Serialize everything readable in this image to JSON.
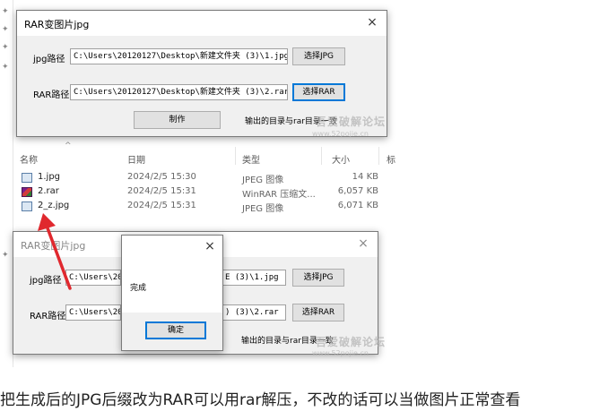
{
  "top_dialog": {
    "title": "RAR变图片jpg",
    "close": "×",
    "jpg_label": "jpg路径",
    "jpg_path": "C:\\Users\\20120127\\Desktop\\新建文件夹 (3)\\1.jpg",
    "jpg_button": "选择JPG",
    "rar_label": "RAR路径",
    "rar_path": "C:\\Users\\20120127\\Desktop\\新建文件夹 (3)\\2.rar",
    "rar_button": "选择RAR",
    "make_button": "制作",
    "output_note": "输出的目录与rar目录一致"
  },
  "explorer": {
    "columns": [
      "名称",
      "日期",
      "类型",
      "大小",
      "标"
    ],
    "files": [
      {
        "name": "1.jpg",
        "date": "2024/2/5 15:30",
        "type": "JPEG 图像",
        "size": "14 KB",
        "icon": "jpeg-file-icon"
      },
      {
        "name": "2.rar",
        "date": "2024/2/5 15:31",
        "type": "WinRAR 压缩文...",
        "size": "6,057 KB",
        "icon": "winrar-file-icon"
      },
      {
        "name": "2_z.jpg",
        "date": "2024/2/5 15:31",
        "type": "JPEG 图像",
        "size": "6,071 KB",
        "icon": "jpeg-file-icon"
      }
    ]
  },
  "bottom_dialog": {
    "title": "RAR变图片jpg",
    "close": "×",
    "jpg_label": "jpg路径",
    "jpg_path_left": "C:\\Users\\2012",
    "jpg_path_right": "E (3)\\1.jpg",
    "jpg_button": "选择JPG",
    "rar_label": "RAR路径",
    "rar_path_left": "C:\\Users\\2012",
    "rar_path_right": ") (3)\\2.rar",
    "rar_button": "选择RAR",
    "output_note": "输出的目录与rar目录一致"
  },
  "message_box": {
    "close": "×",
    "message": "完成",
    "ok_button": "确定"
  },
  "watermark": {
    "text": "吾爱破解论坛",
    "url": "www.52pojie.cn"
  },
  "caption": "把生成后的JPG后缀改为RAR可以用rar解压，不改的话可以当做图片正常查看",
  "colors": {
    "arrow": "#e0282e",
    "focus": "#0078d7"
  }
}
